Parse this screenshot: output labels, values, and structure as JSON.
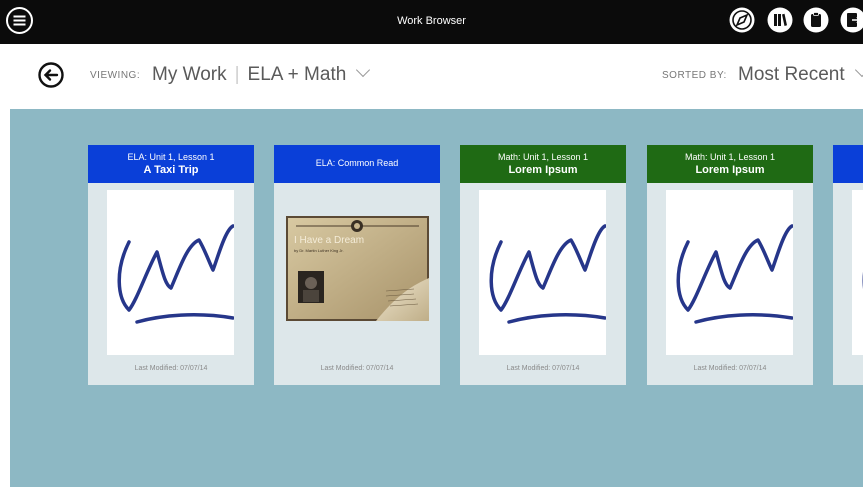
{
  "app": {
    "title": "Work Browser"
  },
  "top_icons": [
    "menu-icon",
    "compass-icon",
    "library-icon",
    "clipboard-icon",
    "exit-icon"
  ],
  "subbar": {
    "viewing_label": "VIEWING:",
    "viewing_primary": "My Work",
    "viewing_secondary": "ELA + Math",
    "sorted_label": "SORTED BY:",
    "sorted_value": "Most Recent"
  },
  "colors": {
    "ela": "#0a3fd8",
    "math": "#1f6a14",
    "background": "#8db8c4"
  },
  "cards": [
    {
      "subject": "ELA",
      "subtitle": "ELA: Unit 1, Lesson 1",
      "title": "A Taxi Trip",
      "thumbnail": "handwriting",
      "footer": "Last Modified: 07/07/14"
    },
    {
      "subject": "ELA",
      "subtitle": "ELA: Common Read",
      "title": "",
      "thumbnail": "reading",
      "footer": "Last Modified: 07/07/14",
      "reading": {
        "title": "I Have a Dream",
        "author": "by Dr. Martin Luther King Jr."
      }
    },
    {
      "subject": "Math",
      "subtitle": "Math: Unit 1, Lesson 1",
      "title": "Lorem Ipsum",
      "thumbnail": "handwriting",
      "footer": "Last Modified: 07/07/14"
    },
    {
      "subject": "Math",
      "subtitle": "Math: Unit 1, Lesson 1",
      "title": "Lorem Ipsum",
      "thumbnail": "handwriting",
      "footer": "Last Modified: 07/07/14"
    },
    {
      "subject": "ELA",
      "subtitle": "",
      "title": "",
      "thumbnail": "handwriting",
      "footer": ""
    }
  ]
}
